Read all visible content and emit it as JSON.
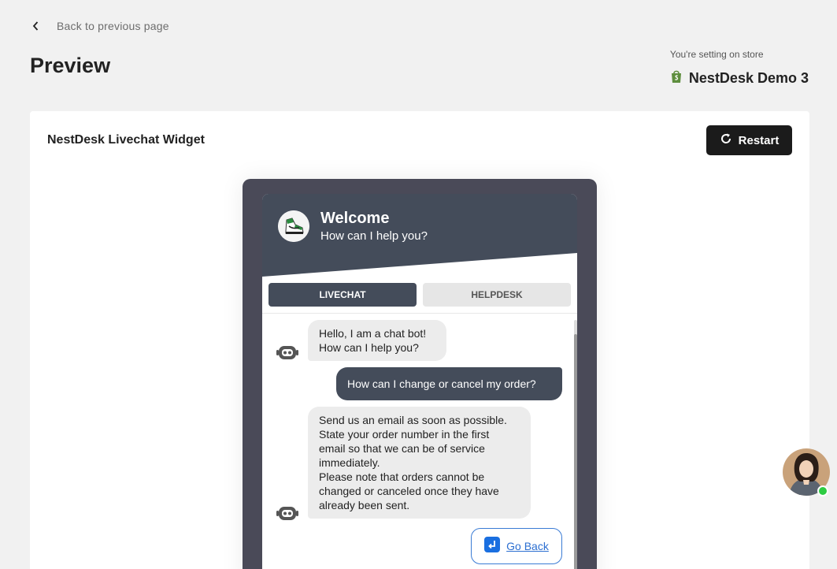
{
  "nav": {
    "back_label": "Back to previous page",
    "back_icon": "chevron-left-icon"
  },
  "page": {
    "title": "Preview"
  },
  "store": {
    "caption": "You're setting on store",
    "name": "NestDesk Demo 3",
    "icon": "shopify-bag-icon",
    "icon_color": "#5e8e3e"
  },
  "card": {
    "title": "NestDesk Livechat Widget",
    "restart_label": "Restart",
    "restart_icon": "refresh-icon"
  },
  "widget": {
    "header_color": "#444c5a",
    "title": "Welcome",
    "subtitle": "How can I help you?",
    "tabs": [
      {
        "label": "LIVECHAT",
        "active": true
      },
      {
        "label": "HELPDESK",
        "active": false
      }
    ],
    "messages": [
      {
        "from": "bot",
        "lines": [
          "Hello, I am a chat bot!",
          "How can I help you?"
        ]
      },
      {
        "from": "user",
        "lines": [
          "How can I change or cancel my order?"
        ]
      },
      {
        "from": "bot",
        "lines": [
          "Send us an email as soon as possible.",
          "State your order number in the first",
          "email so that we can be of service",
          "immediately.",
          "Please note that orders cannot be",
          "changed or canceled once they have",
          "already been sent."
        ]
      }
    ],
    "go_back_label": "Go Back",
    "go_back_icon": "return-arrow-icon"
  },
  "agent": {
    "status_color": "#2dcc42"
  }
}
